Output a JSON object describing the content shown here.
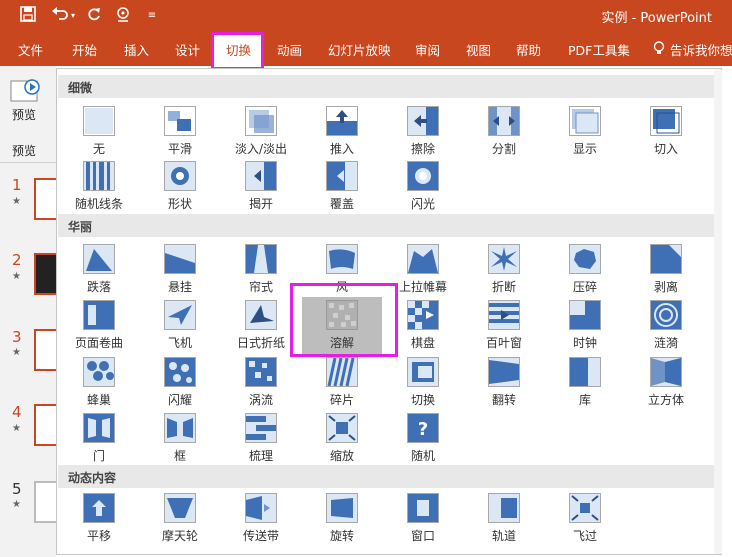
{
  "title": "实例 - PowerPoint",
  "qat": [
    "save-icon",
    "undo-icon",
    "redo-icon",
    "presenter-icon",
    "customize-icon"
  ],
  "tabs": [
    "文件",
    "开始",
    "插入",
    "设计",
    "切换",
    "动画",
    "幻灯片放映",
    "审阅",
    "视图",
    "帮助",
    "PDF工具集",
    "告诉我你想"
  ],
  "active_tab": "切换",
  "left": {
    "preview_label": "预览",
    "group_label": "预览",
    "slides": [
      {
        "num": "1",
        "star": "★"
      },
      {
        "num": "2",
        "star": "★"
      },
      {
        "num": "3",
        "star": "★"
      },
      {
        "num": "4",
        "star": "★"
      },
      {
        "num": "5",
        "star": "★"
      }
    ]
  },
  "sections": [
    {
      "title": "细微",
      "items": [
        "无",
        "平滑",
        "淡入/淡出",
        "推入",
        "擦除",
        "分割",
        "显示",
        "切入",
        "随机线条",
        "形状",
        "揭开",
        "覆盖",
        "闪光"
      ]
    },
    {
      "title": "华丽",
      "items": [
        "跌落",
        "悬挂",
        "帘式",
        "风",
        "上拉帷幕",
        "折断",
        "压碎",
        "剥离",
        "页面卷曲",
        "飞机",
        "日式折纸",
        "溶解",
        "棋盘",
        "百叶窗",
        "时钟",
        "涟漪",
        "蜂巢",
        "闪耀",
        "涡流",
        "碎片",
        "切换",
        "翻转",
        "库",
        "立方体",
        "门",
        "框",
        "梳理",
        "缩放",
        "随机"
      ]
    },
    {
      "title": "动态内容",
      "items": [
        "平移",
        "摩天轮",
        "传送带",
        "旋转",
        "窗口",
        "轨道",
        "飞过"
      ]
    }
  ],
  "selected_item": "溶解",
  "colors": {
    "accent": "#c9471f",
    "highlight": "#e51ee5",
    "icon_blue": "#3f6fb5"
  }
}
